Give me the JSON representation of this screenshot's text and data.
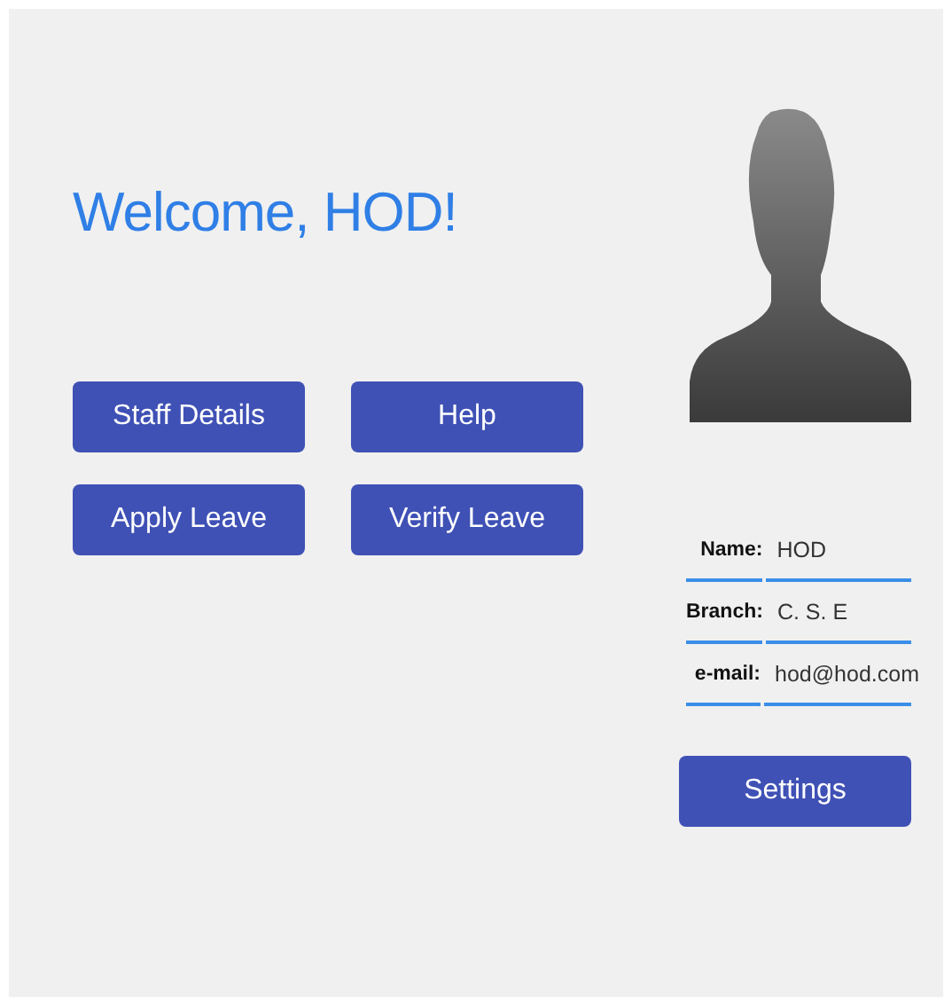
{
  "greeting": "Welcome, HOD!",
  "actions": [
    "Staff Details",
    "Help",
    "Apply Leave",
    "Verify Leave"
  ],
  "profile": {
    "fields": [
      {
        "label": "Name:",
        "value": "HOD"
      },
      {
        "label": "Branch:",
        "value": "C. S. E"
      },
      {
        "label": "e-mail:",
        "value": "hod@hod.com"
      }
    ]
  },
  "settings_button": "Settings"
}
